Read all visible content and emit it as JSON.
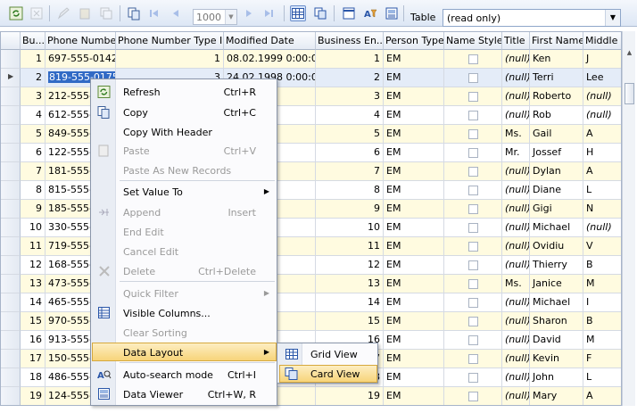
{
  "toolbar": {
    "pager_value": "1000",
    "table_label": "Table",
    "table_value": "(read only)",
    "icons": [
      "refresh-icon",
      "delete-icon",
      "edit-icon",
      "paste-icon",
      "copy-icon",
      "clone-icon",
      "first-record-icon",
      "prev-record-icon",
      "next-record-icon",
      "last-record-icon",
      "grid-view-icon",
      "card-view-icon",
      "columns-icon",
      "filter-icon",
      "data-viewer-icon"
    ]
  },
  "grid": {
    "columns": [
      "Bu...",
      "Phone Number",
      "Phone Number Type ID",
      "Modified Date",
      "Business En...",
      "Person Type",
      "Name Style",
      "Title",
      "First Name",
      "Middle"
    ],
    "rows": [
      [
        "1",
        "697-555-0142",
        "1",
        "08.02.1999 0:00:00",
        "1",
        "EM",
        "",
        "(null)",
        "Ken",
        "J"
      ],
      [
        "2",
        "819-555-0175",
        "3",
        "24.02.1998 0:00:00",
        "2",
        "EM",
        "",
        "(null)",
        "Terri",
        "Lee"
      ],
      [
        "3",
        "212-555-",
        "",
        "",
        "3",
        "EM",
        "",
        "(null)",
        "Roberto",
        "(null)"
      ],
      [
        "4",
        "612-555-",
        "",
        "",
        "4",
        "EM",
        "",
        "(null)",
        "Rob",
        "(null)"
      ],
      [
        "5",
        "849-555-",
        "",
        "",
        "5",
        "EM",
        "",
        "Ms.",
        "Gail",
        "A"
      ],
      [
        "6",
        "122-555-",
        "",
        "",
        "6",
        "EM",
        "",
        "Mr.",
        "Jossef",
        "H"
      ],
      [
        "7",
        "181-555-",
        "",
        "",
        "7",
        "EM",
        "",
        "(null)",
        "Dylan",
        "A"
      ],
      [
        "8",
        "815-555-",
        "",
        "",
        "8",
        "EM",
        "",
        "(null)",
        "Diane",
        "L"
      ],
      [
        "9",
        "185-555-",
        "",
        "",
        "9",
        "EM",
        "",
        "(null)",
        "Gigi",
        "N"
      ],
      [
        "10",
        "330-555-",
        "",
        "",
        "10",
        "EM",
        "",
        "(null)",
        "Michael",
        "(null)"
      ],
      [
        "11",
        "719-555-",
        "",
        "",
        "11",
        "EM",
        "",
        "(null)",
        "Ovidiu",
        "V"
      ],
      [
        "12",
        "168-555-",
        "",
        "",
        "12",
        "EM",
        "",
        "(null)",
        "Thierry",
        "B"
      ],
      [
        "13",
        "473-555-",
        "",
        "",
        "13",
        "EM",
        "",
        "Ms.",
        "Janice",
        "M"
      ],
      [
        "14",
        "465-555-",
        "",
        "",
        "14",
        "EM",
        "",
        "(null)",
        "Michael",
        "I"
      ],
      [
        "15",
        "970-555-",
        "",
        "",
        "15",
        "EM",
        "",
        "(null)",
        "Sharon",
        "B"
      ],
      [
        "16",
        "913-555-",
        "",
        "",
        "16",
        "EM",
        "",
        "(null)",
        "David",
        "M"
      ],
      [
        "17",
        "150-555-",
        "",
        "",
        "17",
        "EM",
        "",
        "(null)",
        "Kevin",
        "F"
      ],
      [
        "18",
        "486-555-",
        "",
        "",
        "18",
        "EM",
        "",
        "(null)",
        "John",
        "L"
      ],
      [
        "19",
        "124-555-",
        "",
        "",
        "19",
        "EM",
        "",
        "(null)",
        "Mary",
        "A"
      ]
    ]
  },
  "menu": {
    "items": [
      {
        "label": "Refresh",
        "shortcut": "Ctrl+R",
        "icon": "refresh-icon",
        "enabled": true
      },
      {
        "label": "Copy",
        "shortcut": "Ctrl+C",
        "icon": "copy-icon",
        "enabled": true
      },
      {
        "label": "Copy With Header",
        "shortcut": "",
        "icon": "",
        "enabled": true
      },
      {
        "label": "Paste",
        "shortcut": "Ctrl+V",
        "icon": "paste-icon",
        "enabled": false
      },
      {
        "label": "Paste As New Records",
        "shortcut": "",
        "icon": "",
        "enabled": false
      },
      {
        "label": "Set Value To",
        "shortcut": "",
        "icon": "",
        "enabled": true,
        "submenu": true
      },
      {
        "label": "Append",
        "shortcut": "Insert",
        "icon": "append-icon",
        "enabled": false
      },
      {
        "label": "End Edit",
        "shortcut": "",
        "icon": "",
        "enabled": false
      },
      {
        "label": "Cancel Edit",
        "shortcut": "",
        "icon": "",
        "enabled": false
      },
      {
        "label": "Delete",
        "shortcut": "Ctrl+Delete",
        "icon": "delete-icon",
        "enabled": false
      },
      {
        "label": "Quick Filter",
        "shortcut": "",
        "icon": "",
        "enabled": false,
        "submenu": true
      },
      {
        "label": "Visible Columns...",
        "shortcut": "",
        "icon": "columns-icon",
        "enabled": true
      },
      {
        "label": "Clear Sorting",
        "shortcut": "",
        "icon": "",
        "enabled": false
      },
      {
        "label": "Data Layout",
        "shortcut": "",
        "icon": "",
        "enabled": true,
        "submenu": true,
        "highlighted": true
      },
      {
        "label": "Auto-search mode",
        "shortcut": "Ctrl+I",
        "icon": "auto-search-icon",
        "enabled": true
      },
      {
        "label": "Data Viewer",
        "shortcut": "Ctrl+W, R",
        "icon": "data-viewer-icon",
        "enabled": true
      }
    ]
  },
  "submenu": {
    "items": [
      {
        "label": "Grid View",
        "icon": "grid-view-icon"
      },
      {
        "label": "Card View",
        "icon": "card-view-icon",
        "highlighted": true
      }
    ]
  },
  "colors": {
    "row_highlight": "#fffbe0",
    "selection": "#316ac5",
    "menu_highlight": "#f7d47a"
  }
}
